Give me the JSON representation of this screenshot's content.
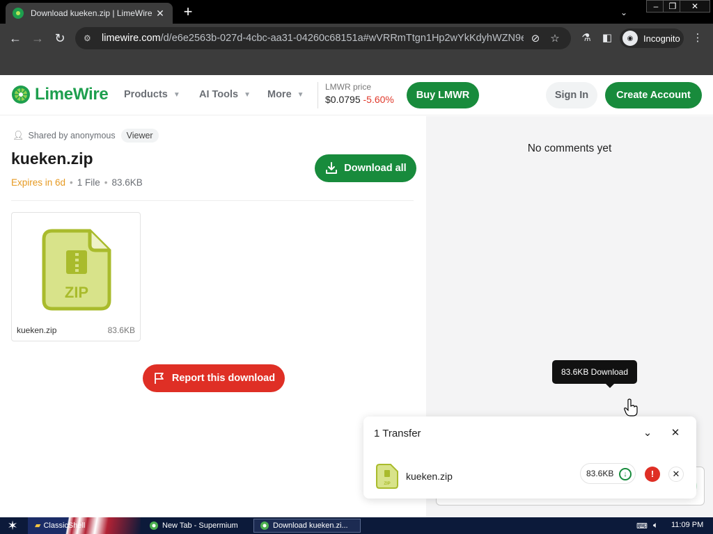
{
  "browser": {
    "tab_title": "Download kueken.zip | LimeWire",
    "url_host": "limewire.com",
    "url_path": "/d/e6e2563b-027d-4cbc-aa31-04260c68151a#wVRRmTtgn1Hp2wYkKdyhWZN9eYGY...",
    "incognito_label": "Incognito"
  },
  "header": {
    "brand": "LimeWire",
    "nav": [
      "Products",
      "AI Tools",
      "More"
    ],
    "price_label": "LMWR price",
    "price_value": "$0.0795",
    "price_change": "-5.60%",
    "buy_button": "Buy LMWR",
    "sign_in": "Sign In",
    "create_account": "Create Account"
  },
  "share": {
    "shared_by": "Shared by anonymous",
    "role_badge": "Viewer",
    "title": "kueken.zip",
    "expires": "Expires in 6d",
    "file_count": "1 File",
    "total_size": "83.6KB",
    "download_all": "Download all",
    "report": "Report this download"
  },
  "file_card": {
    "name": "kueken.zip",
    "size": "83.6KB",
    "badge": "ZIP"
  },
  "comments": {
    "empty_text": "No comments yet"
  },
  "transfer_panel": {
    "heading": "1 Transfer",
    "file_name": "kueken.zip",
    "file_size": "83.6KB",
    "tooltip": "83.6KB Download",
    "warning_glyph": "!"
  },
  "taskbar": {
    "items": [
      "ClassicShell",
      "New Tab - Supermium",
      "Download kueken.zi..."
    ],
    "clock": "11:09 PM"
  },
  "colors": {
    "brand_green": "#188b3c",
    "danger_red": "#df2f25",
    "expire_orange": "#e69a22"
  }
}
